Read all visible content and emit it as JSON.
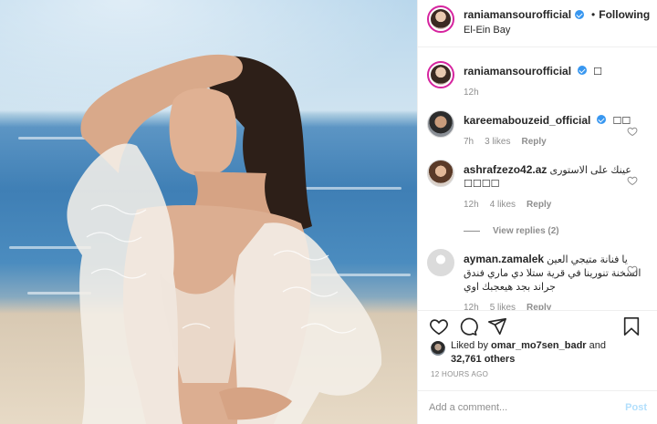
{
  "header": {
    "username": "raniamansourofficial",
    "separator": "•",
    "follow_label": "Following",
    "location": "El-Ein Bay"
  },
  "caption": {
    "username": "raniamansourofficial",
    "text": "☐",
    "age": "12h"
  },
  "comments": [
    {
      "username": "kareemabouzeid_official",
      "verified": true,
      "text": "☐☐",
      "age": "7h",
      "likes": "3 likes",
      "reply_label": "Reply"
    },
    {
      "username": "ashrafzezo42.az",
      "verified": false,
      "text": "عينك على الاستورى",
      "text2": "☐☐☐☐",
      "age": "12h",
      "likes": "4 likes",
      "reply_label": "Reply",
      "view_replies": "View replies (2)"
    },
    {
      "username": "ayman.zamalek",
      "verified": false,
      "text": "يا فنانة متيجي العين السخنة تنورينا في قرية ستلا دي ماري فندق جراند بجد هيعجبك اوي",
      "age": "12h",
      "likes": "5 likes",
      "reply_label": "Reply"
    }
  ],
  "likes": {
    "prefix": "Liked by",
    "user": "omar_mo7sen_badr",
    "and": "and",
    "count": "32,761 others"
  },
  "timestamp": "12 HOURS AGO",
  "add_comment": {
    "placeholder": "Add a comment...",
    "post_label": "Post"
  },
  "colors": {
    "verified": "#3897f0",
    "post_disabled": "#b2dffc",
    "muted": "#8e8e8e"
  },
  "icons": [
    "heart-icon",
    "comment-icon",
    "share-icon",
    "bookmark-icon",
    "verified-badge-icon"
  ]
}
